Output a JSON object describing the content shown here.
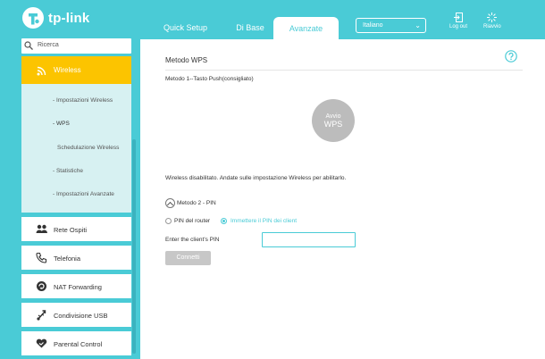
{
  "brand": {
    "logo_text": "tp-link",
    "accent": "#4acbd6",
    "active_yellow": "#fcc400"
  },
  "header": {
    "tabs": [
      "Quick Setup",
      "Di Base",
      "Avanzate"
    ],
    "active_tab": "Avanzate",
    "language": "Italiano",
    "logout_label": "Log out",
    "reboot_label": "Riavvio"
  },
  "sidebar": {
    "search_placeholder": "Ricerca",
    "active_item": {
      "label": "Wireless",
      "icon": "wifi-icon"
    },
    "subitems": [
      "- Impostazioni Wireless",
      "- WPS",
      "Schedulazione Wireless",
      "- Statistiche",
      "- Impostazioni Avanzate"
    ],
    "items": [
      {
        "label": "Rete Ospiti",
        "icon": "users-icon"
      },
      {
        "label": "Telefonia",
        "icon": "phone-icon"
      },
      {
        "label": "NAT Forwarding",
        "icon": "nat-icon"
      },
      {
        "label": "Condivisione USB",
        "icon": "usb-icon"
      },
      {
        "label": "Parental Control",
        "icon": "heart-icon"
      }
    ]
  },
  "main": {
    "title": "Metodo WPS",
    "method1_label": "Metodo 1--Tasto Push(consigliato)",
    "wps_button_line1": "Avvio",
    "wps_button_line2": "WPS",
    "warning": "Wireless disabilitato. Andate sulle impostazione Wireless per abilitarlo.",
    "method2_label": "Metodo 2 - PIN",
    "radio_options": [
      "PIN del router",
      "Immettere il PIN dei client"
    ],
    "selected_option": "Immettere il PIN dei client",
    "pin_label": "Enter the client's PIN",
    "pin_value": "",
    "connect_label": "Connetti"
  }
}
